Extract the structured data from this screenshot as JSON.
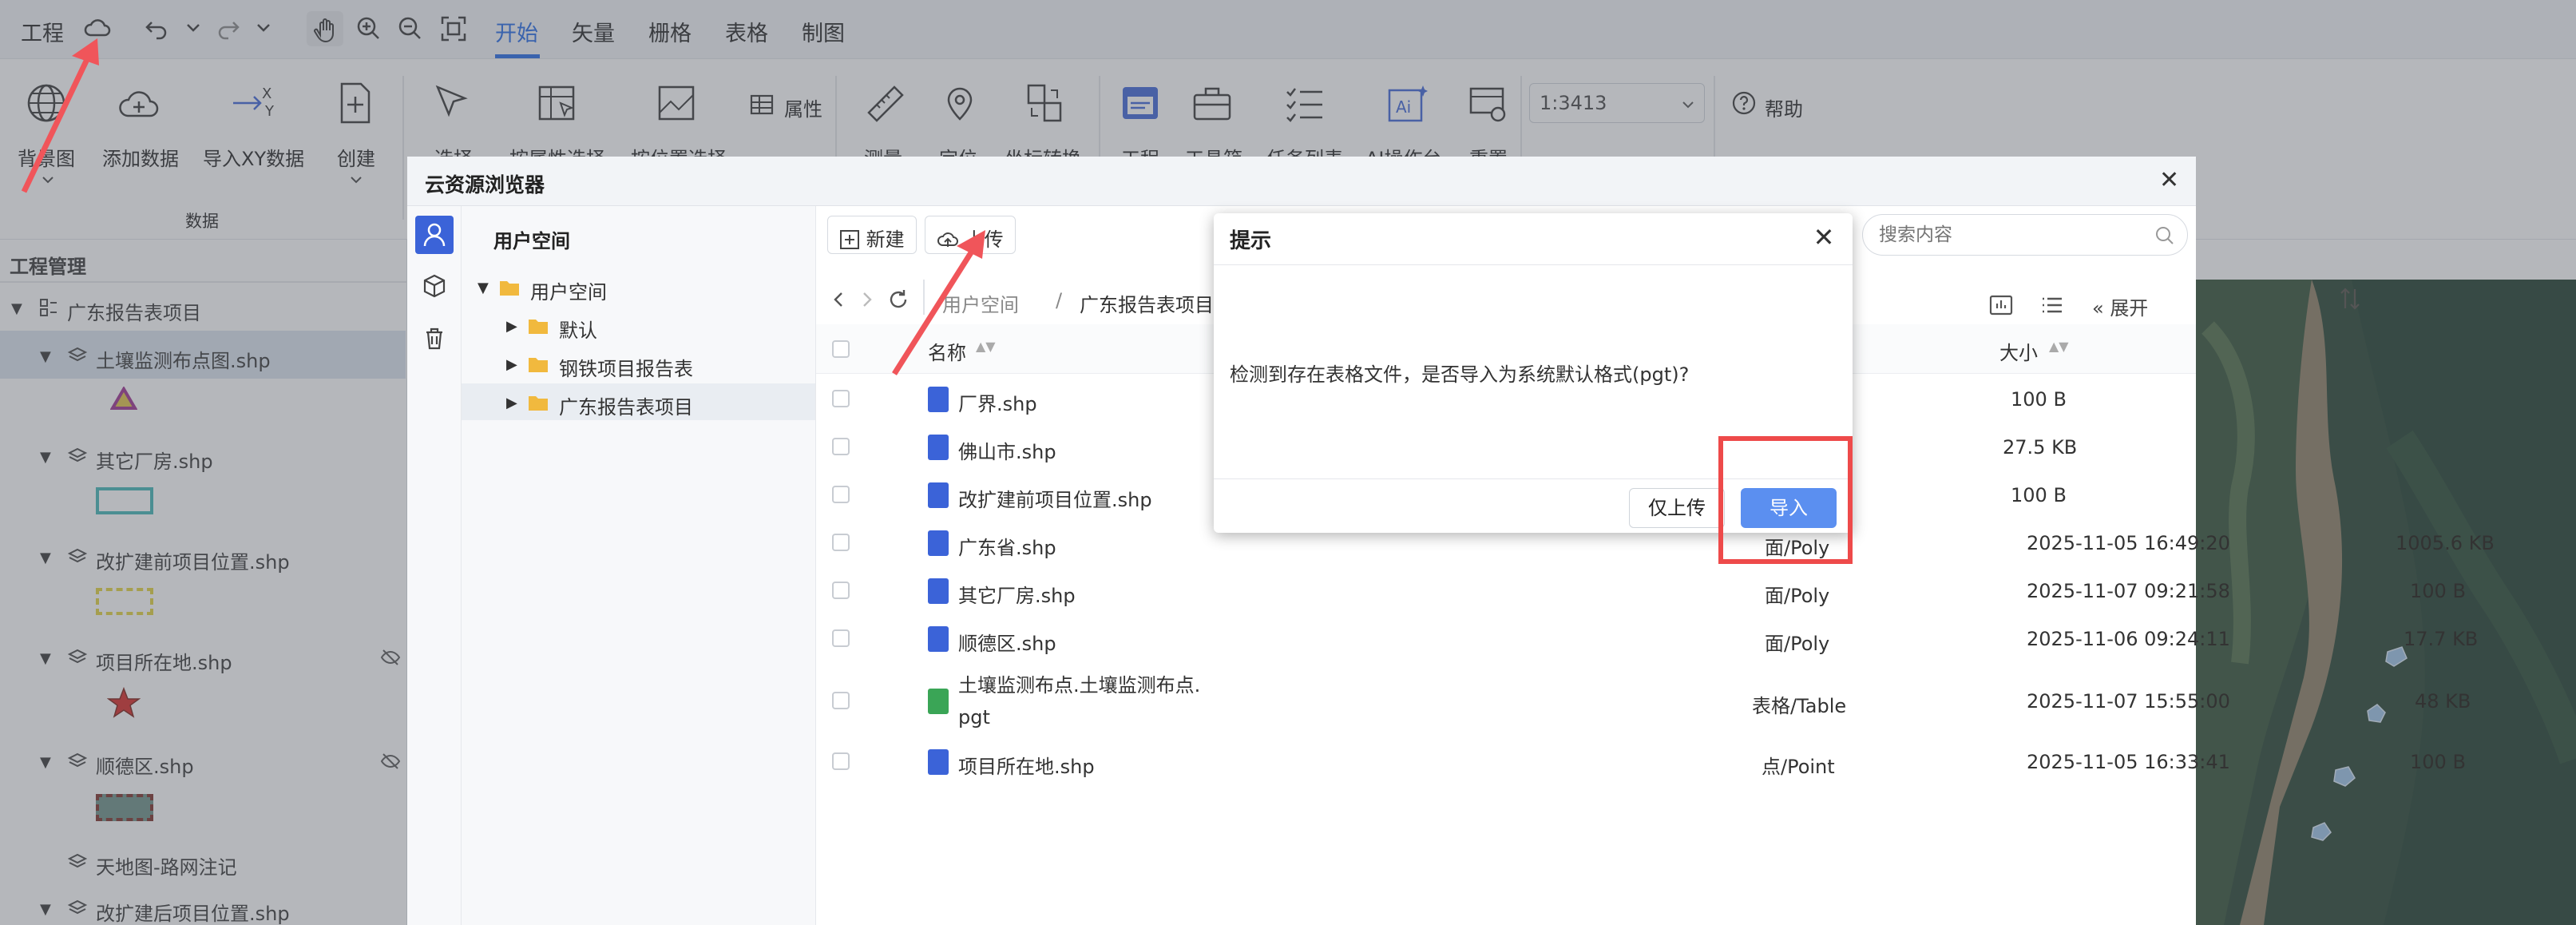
{
  "titlebar": {
    "project_label": "工程",
    "tabs": [
      "开始",
      "矢量",
      "栅格",
      "表格",
      "制图"
    ],
    "active_tab": "开始"
  },
  "ribbon": {
    "data_group": {
      "items": [
        "背景图",
        "添加数据",
        "导入XY数据",
        "创建"
      ],
      "group_label": "数据"
    },
    "select_items": [
      "选择",
      "按属性选择",
      "按位置选择"
    ],
    "attribute_label": "属性",
    "tool_items": [
      "测量",
      "定位",
      "坐标转换"
    ],
    "panel_items": [
      "工程",
      "工具箱",
      "任务列表",
      "AI操作台",
      "重置"
    ],
    "scale_value": "1:3413",
    "help_label": "帮助"
  },
  "left_panel": {
    "title": "工程管理",
    "tree": [
      {
        "label": "广东报告表项目",
        "level": 0,
        "symbol": "group"
      },
      {
        "label": "土壤监测布点图.shp",
        "level": 1,
        "symbol": "triangle",
        "selected": true
      },
      {
        "label": "其它厂房.shp",
        "level": 1,
        "symbol": "cyan-rect"
      },
      {
        "label": "改扩建前项目位置.shp",
        "level": 1,
        "symbol": "yellow-dashed-rect"
      },
      {
        "label": "项目所在地.shp",
        "level": 1,
        "symbol": "red-star",
        "hidden": true
      },
      {
        "label": "顺德区.shp",
        "level": 1,
        "symbol": "dashed-teal-rect",
        "hidden": true
      },
      {
        "label": "天地图-路网注记",
        "level": 1,
        "symbol": "none"
      },
      {
        "label": "改扩建后项目位置.shp",
        "level": 1,
        "symbol": "none"
      }
    ]
  },
  "browser": {
    "title": "云资源浏览器",
    "tree_header": "用户空间",
    "tree": [
      {
        "label": "用户空间",
        "level": 0,
        "expanded": true
      },
      {
        "label": "默认",
        "level": 1
      },
      {
        "label": "钢铁项目报告表",
        "level": 1
      },
      {
        "label": "广东报告表项目",
        "level": 1,
        "selected": true
      }
    ],
    "toolbar": {
      "new_label": "新建",
      "upload_label": "上传",
      "search_placeholder": "搜索内容"
    },
    "breadcrumb": [
      "用户空间",
      "广东报告表项目"
    ],
    "expand_label": "展开",
    "columns": {
      "name": "名称",
      "size": "大小"
    },
    "rows": [
      {
        "name": "厂界.shp",
        "type": "",
        "date": "",
        "size": "100 B",
        "icon": "shp"
      },
      {
        "name": "佛山市.shp",
        "type": "",
        "date": "",
        "size": "27.5 KB",
        "icon": "shp"
      },
      {
        "name": "改扩建前项目位置.shp",
        "type": "",
        "date": "",
        "size": "100 B",
        "icon": "shp"
      },
      {
        "name": "广东省.shp",
        "type": "面/Poly",
        "date": "2025-11-05 16:49:20",
        "size": "1005.6 KB",
        "icon": "shp"
      },
      {
        "name": "其它厂房.shp",
        "type": "面/Poly",
        "date": "2025-11-07 09:21:58",
        "size": "100 B",
        "icon": "shp"
      },
      {
        "name": "顺德区.shp",
        "type": "面/Poly",
        "date": "2025-11-06 09:24:11",
        "size": "17.7 KB",
        "icon": "shp"
      },
      {
        "name_line1": "土壤监测布点.土壤监测布点.",
        "name_line2": "pgt",
        "type": "表格/Table",
        "date": "2025-11-07 15:55:00",
        "size": "48 KB",
        "icon": "table"
      },
      {
        "name": "项目所在地.shp",
        "type": "点/Point",
        "date": "2025-11-05 16:33:41",
        "size": "100 B",
        "icon": "point"
      }
    ]
  },
  "dialog": {
    "title": "提示",
    "message": "检测到存在表格文件，是否导入为系统默认格式(pgt)?",
    "upload_only_label": "仅上传",
    "import_label": "导入"
  },
  "colors": {
    "accent": "#1f66e5",
    "primary_button": "#5b8ff0",
    "highlight": "#ee4a4a"
  }
}
